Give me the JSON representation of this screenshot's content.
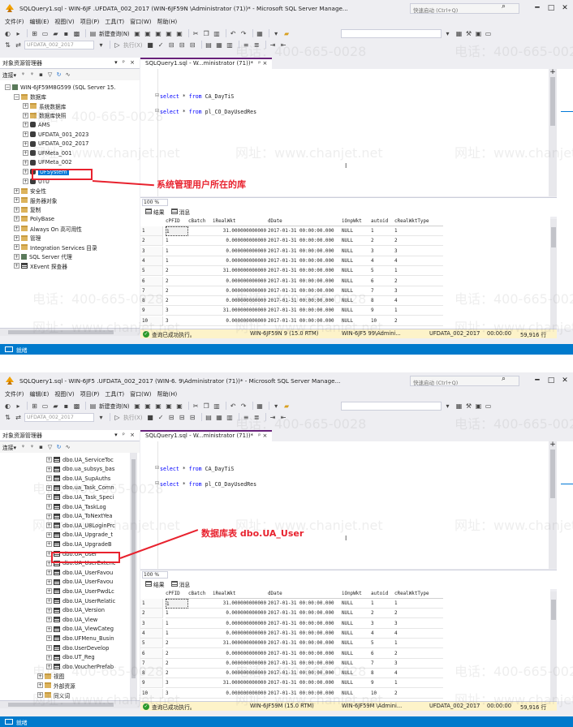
{
  "colors": {
    "accent": "#007acc",
    "selection": "#0078d7",
    "annotation": "#e8222e",
    "tab_accent": "#68217a",
    "keyword": "#0000ff",
    "status_ok": "#2b9a2b",
    "query_status_bg": "#fdf3c9"
  },
  "icons": [
    "ssms-logo-icon",
    "search-icon",
    "minimize-icon",
    "maximize-icon",
    "close-icon",
    "new-query-icon",
    "save-icon",
    "execute-icon",
    "connect-icon",
    "filter-icon",
    "refresh-icon",
    "folder-icon",
    "database-icon",
    "table-icon",
    "server-icon",
    "grid-results-icon",
    "messages-icon",
    "success-icon"
  ],
  "watermark": {
    "phone": "电话：400-665-0028",
    "site": "网址：www.chanjet.net"
  },
  "screens": [
    {
      "window_title": "SQLQuery1.sql - WIN-6JF          .UFDATA_002_2017 (WIN-6JF59N        \\Administrator (71))* - Microsoft SQL Server Manage...",
      "quick_launch": "快速启动 (Ctrl+Q)",
      "menu": [
        "文件(F)",
        "编辑(E)",
        "视图(V)",
        "项目(P)",
        "工具(T)",
        "窗口(W)",
        "帮助(H)"
      ],
      "toolbar_new_query": "新建查询(N)",
      "toolbar_db": "UFDATA_002_2017",
      "toolbar_execute": "执行(X)",
      "oe_title": "对象资源管理器",
      "oe_header_controls": "▾ ᵖ ×",
      "oe_connect": "连接▾",
      "tree": [
        {
          "label": "WIN-6JF59M8G599 (SQL Server 15.",
          "indent": 0,
          "icon": "server",
          "exp": "−"
        },
        {
          "label": "数据库",
          "indent": 1,
          "icon": "folder",
          "exp": "−"
        },
        {
          "label": "系统数据库",
          "indent": 2,
          "icon": "folder",
          "exp": "+"
        },
        {
          "label": "数据库快照",
          "indent": 2,
          "icon": "folder",
          "exp": "+"
        },
        {
          "label": "AMS",
          "indent": 2,
          "icon": "db",
          "exp": "+"
        },
        {
          "label": "UFDATA_001_2023",
          "indent": 2,
          "icon": "db",
          "exp": "+"
        },
        {
          "label": "UFDATA_002_2017",
          "indent": 2,
          "icon": "db",
          "exp": "+"
        },
        {
          "label": "UFMeta_001",
          "indent": 2,
          "icon": "db",
          "exp": "+"
        },
        {
          "label": "UFMeta_002",
          "indent": 2,
          "icon": "db",
          "exp": "+"
        },
        {
          "label": "UFSystem",
          "indent": 2,
          "icon": "db",
          "exp": "+",
          "selected": true
        },
        {
          "label": "UTU",
          "indent": 2,
          "icon": "db",
          "exp": "+"
        },
        {
          "label": "安全性",
          "indent": 1,
          "icon": "folder",
          "exp": "+"
        },
        {
          "label": "服务器对象",
          "indent": 1,
          "icon": "folder",
          "exp": "+"
        },
        {
          "label": "复制",
          "indent": 1,
          "icon": "folder",
          "exp": "+"
        },
        {
          "label": "PolyBase",
          "indent": 1,
          "icon": "folder",
          "exp": "+"
        },
        {
          "label": "Always On 高可用性",
          "indent": 1,
          "icon": "folder",
          "exp": "+"
        },
        {
          "label": "管理",
          "indent": 1,
          "icon": "folder",
          "exp": "+"
        },
        {
          "label": "Integration Services 目录",
          "indent": 1,
          "icon": "folder",
          "exp": "+"
        },
        {
          "label": "SQL Server 代理",
          "indent": 1,
          "icon": "server",
          "exp": "+"
        },
        {
          "label": "XEvent 探查器",
          "indent": 1,
          "icon": "table",
          "exp": "+"
        }
      ],
      "tab_title": "SQLQuery1.sql - W...ministrator (71))*",
      "tab_controls": "ᵖ ×",
      "code": [
        {
          "kw1": "select",
          "mid": " * ",
          "kw2": "from",
          "tail": " CA_DayTiS"
        },
        {
          "kw1": "select",
          "mid": " * ",
          "kw2": "from",
          "tail": " pl_CO_DayUsedRes"
        }
      ],
      "zoom": "100 %",
      "results_tab": "结果",
      "messages_tab": "消息",
      "annotation": "系统管理用户所在的库",
      "status_ready": "就绪",
      "query_status": {
        "message": "查询已成功执行。",
        "server": "WIN-6JF59N         9 (15.0 RTM)",
        "user": "WIN-6JF5          99\\Admini...",
        "db": "UFDATA_002_2017",
        "time": "00:00:00",
        "rows": "59,916 行"
      }
    },
    {
      "window_title": "SQLQuery1.sql - WIN-6JF5          .UFDATA_002_2017 (WIN-6.             9\\Administrator (71))* - Microsoft SQL Server Manage...",
      "quick_launch": "快速启动 (Ctrl+Q)",
      "menu": [
        "文件(F)",
        "编辑(E)",
        "视图(V)",
        "项目(P)",
        "工具(T)",
        "窗口(W)",
        "帮助(H)"
      ],
      "toolbar_new_query": "新建查询(N)",
      "toolbar_db": "UFDATA_002_2017",
      "toolbar_execute": "执行(X)",
      "oe_title": "对象资源管理器",
      "oe_header_controls": "▾ ᵖ ×",
      "oe_connect": "连接▾",
      "tree": [
        {
          "label": "dbo.UA_ServiceToc",
          "indent": 3,
          "icon": "table",
          "exp": "+"
        },
        {
          "label": "dbo.ua_subsys_bas",
          "indent": 3,
          "icon": "table",
          "exp": "+"
        },
        {
          "label": "dbo.UA_SupAuths",
          "indent": 3,
          "icon": "table",
          "exp": "+"
        },
        {
          "label": "dbo.ua_Task_Comn",
          "indent": 3,
          "icon": "table",
          "exp": "+"
        },
        {
          "label": "dbo.UA_Task_Speci",
          "indent": 3,
          "icon": "table",
          "exp": "+"
        },
        {
          "label": "dbo.UA_TaskLog",
          "indent": 3,
          "icon": "table",
          "exp": "+"
        },
        {
          "label": "dbo.UA_ToNextYea",
          "indent": 3,
          "icon": "table",
          "exp": "+"
        },
        {
          "label": "dbo.UA_U8LoginPrc",
          "indent": 3,
          "icon": "table",
          "exp": "+"
        },
        {
          "label": "dbo.UA_Upgrade_t",
          "indent": 3,
          "icon": "table",
          "exp": "+"
        },
        {
          "label": "dbo.UA_UpgradeB",
          "indent": 3,
          "icon": "table",
          "exp": "+"
        },
        {
          "label": "dbo.UA_User",
          "indent": 3,
          "icon": "table",
          "exp": "+",
          "boxed": true
        },
        {
          "label": "dbo.UA_UserExtenc",
          "indent": 3,
          "icon": "table",
          "exp": "+"
        },
        {
          "label": "dbo.UA_UserFavou",
          "indent": 3,
          "icon": "table",
          "exp": "+"
        },
        {
          "label": "dbo.UA_UserFavou",
          "indent": 3,
          "icon": "table",
          "exp": "+"
        },
        {
          "label": "dbo.UA_UserPwdLc",
          "indent": 3,
          "icon": "table",
          "exp": "+"
        },
        {
          "label": "dbo.UA_UserRelatic",
          "indent": 3,
          "icon": "table",
          "exp": "+"
        },
        {
          "label": "dbo.UA_Version",
          "indent": 3,
          "icon": "table",
          "exp": "+"
        },
        {
          "label": "dbo.UA_View",
          "indent": 3,
          "icon": "table",
          "exp": "+"
        },
        {
          "label": "dbo.UA_ViewCateg",
          "indent": 3,
          "icon": "table",
          "exp": "+"
        },
        {
          "label": "dbo.UFMenu_Busin",
          "indent": 3,
          "icon": "table",
          "exp": "+"
        },
        {
          "label": "dbo.UserDevelop",
          "indent": 3,
          "icon": "table",
          "exp": "+"
        },
        {
          "label": "dbo.UT_Reg",
          "indent": 3,
          "icon": "table",
          "exp": "+"
        },
        {
          "label": "dbo.VoucherPrefab",
          "indent": 3,
          "icon": "table",
          "exp": "+"
        },
        {
          "label": "视图",
          "indent": 2,
          "icon": "folder",
          "exp": "+"
        },
        {
          "label": "外部资源",
          "indent": 2,
          "icon": "folder",
          "exp": "+"
        },
        {
          "label": "同义词",
          "indent": 2,
          "icon": "folder",
          "exp": "+"
        }
      ],
      "tab_title": "SQLQuery1.sql - W...ministrator (71))*",
      "tab_controls": "ᵖ ×",
      "code": [
        {
          "kw1": "select",
          "mid": " * ",
          "kw2": "from",
          "tail": " CA_DayTiS"
        },
        {
          "kw1": "select",
          "mid": " * ",
          "kw2": "from",
          "tail": " pl_CO_DayUsedRes"
        }
      ],
      "zoom": "100 %",
      "results_tab": "结果",
      "messages_tab": "消息",
      "annotation": "数据库表 dbo.UA_User",
      "status_ready": "就绪",
      "query_status": {
        "message": "查询已成功执行。",
        "server": "WIN-6JF59M         (15.0 RTM)",
        "user": "WIN-6JF59M           \\Admini...",
        "db": "UFDATA_002_2017",
        "time": "00:00:00",
        "rows": "59,916 行"
      }
    }
  ],
  "grid": {
    "columns": [
      "cPFID",
      "cBatch",
      "iRealWkt",
      "dDate",
      "iOnpWkt",
      "autoid",
      "cRealWktType"
    ],
    "rows": [
      [
        "1",
        "1",
        "",
        "31.000000000000",
        "2017-01-31 00:00:00.000",
        "NULL",
        "1",
        "1"
      ],
      [
        "2",
        "1",
        "",
        "0.000000000000",
        "2017-01-31 00:00:00.000",
        "NULL",
        "2",
        "2"
      ],
      [
        "3",
        "1",
        "",
        "0.000000000000",
        "2017-01-31 00:00:00.000",
        "NULL",
        "3",
        "3"
      ],
      [
        "4",
        "1",
        "",
        "0.000000000000",
        "2017-01-31 00:00:00.000",
        "NULL",
        "4",
        "4"
      ],
      [
        "5",
        "2",
        "",
        "31.000000000000",
        "2017-01-31 00:00:00.000",
        "NULL",
        "5",
        "1"
      ],
      [
        "6",
        "2",
        "",
        "0.000000000000",
        "2017-01-31 00:00:00.000",
        "NULL",
        "6",
        "2"
      ],
      [
        "7",
        "2",
        "",
        "0.000000000000",
        "2017-01-31 00:00:00.000",
        "NULL",
        "7",
        "3"
      ],
      [
        "8",
        "2",
        "",
        "0.000000000000",
        "2017-01-31 00:00:00.000",
        "NULL",
        "8",
        "4"
      ],
      [
        "9",
        "3",
        "",
        "31.000000000000",
        "2017-01-31 00:00:00.000",
        "NULL",
        "9",
        "1"
      ],
      [
        "10",
        "3",
        "",
        "0.000000000000",
        "2017-01-31 00:00:00.000",
        "NULL",
        "10",
        "2"
      ]
    ]
  }
}
